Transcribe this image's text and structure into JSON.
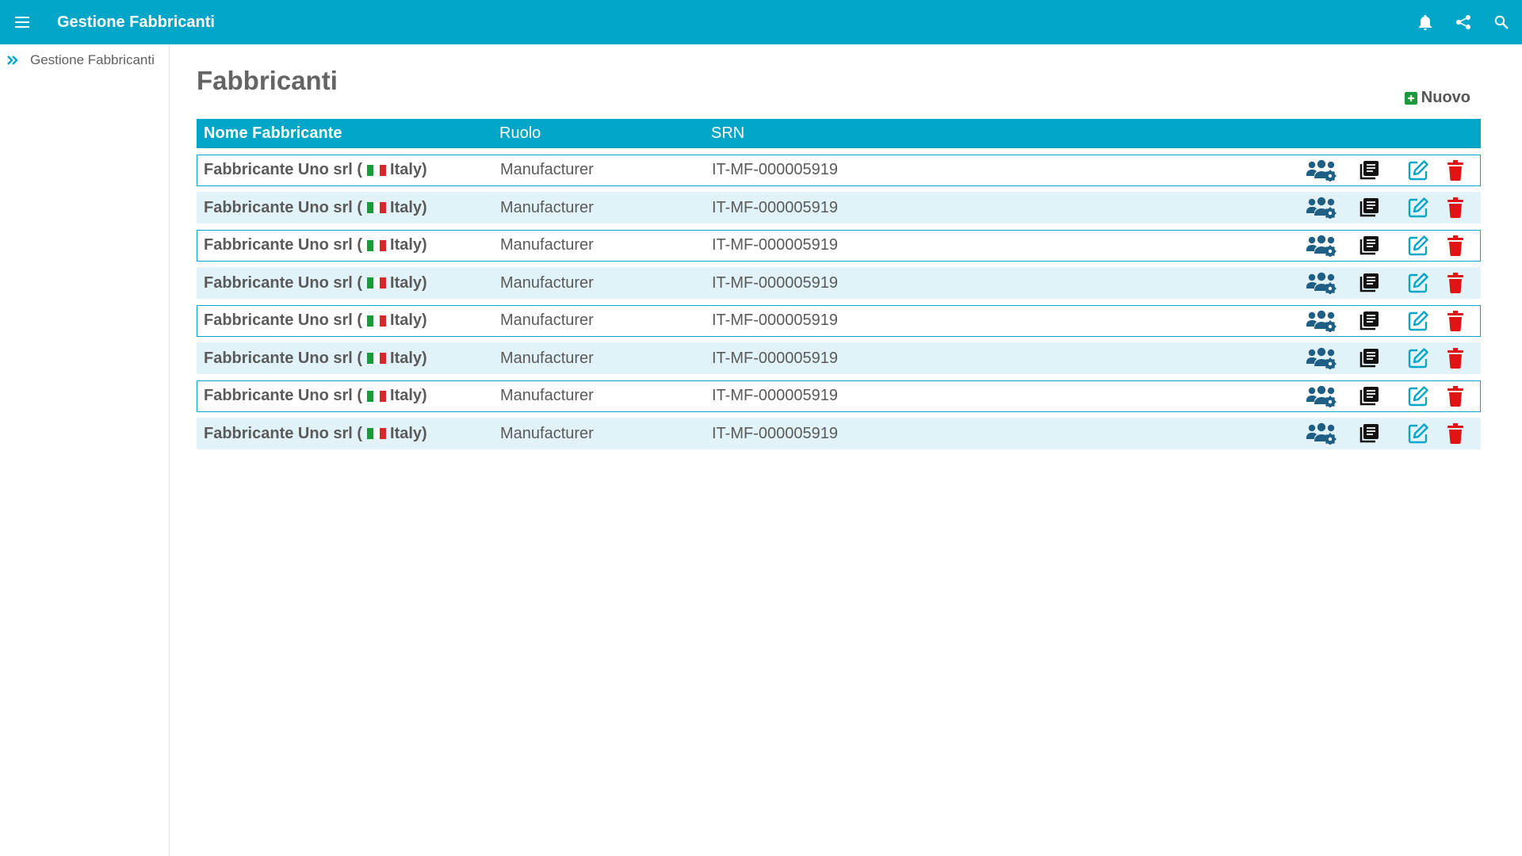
{
  "header": {
    "title": "Gestione Fabbricanti",
    "color": "#00A6C7",
    "icons": [
      "menu-icon",
      "bell-icon",
      "share-icon",
      "search-icon"
    ]
  },
  "sidebar": {
    "items": [
      {
        "label": "Gestione Fabbricanti",
        "icon": "double-chevron-right-icon"
      }
    ]
  },
  "main": {
    "title": "Fabbricanti",
    "new_button_label": "Nuovo"
  },
  "table": {
    "columns": [
      "Nome Fabbricante",
      "Ruolo",
      "SRN"
    ],
    "rows": [
      {
        "name": "Fabbricante Uno srl (",
        "country": "Italy)",
        "role": "Manufacturer",
        "srn": "IT-MF-000005919"
      },
      {
        "name": "Fabbricante Uno srl (",
        "country": "Italy)",
        "role": "Manufacturer",
        "srn": "IT-MF-000005919"
      },
      {
        "name": "Fabbricante Uno srl (",
        "country": "Italy)",
        "role": "Manufacturer",
        "srn": "IT-MF-000005919"
      },
      {
        "name": "Fabbricante Uno srl (",
        "country": "Italy)",
        "role": "Manufacturer",
        "srn": "IT-MF-000005919"
      },
      {
        "name": "Fabbricante Uno srl (",
        "country": "Italy)",
        "role": "Manufacturer",
        "srn": "IT-MF-000005919"
      },
      {
        "name": "Fabbricante Uno srl (",
        "country": "Italy)",
        "role": "Manufacturer",
        "srn": "IT-MF-000005919"
      },
      {
        "name": "Fabbricante Uno srl (",
        "country": "Italy)",
        "role": "Manufacturer",
        "srn": "IT-MF-000005919"
      },
      {
        "name": "Fabbricante Uno srl (",
        "country": "Italy)",
        "role": "Manufacturer",
        "srn": "IT-MF-000005919"
      }
    ],
    "row_actions": [
      "users-cog-icon",
      "book-icon",
      "edit-icon",
      "trash-icon"
    ]
  }
}
